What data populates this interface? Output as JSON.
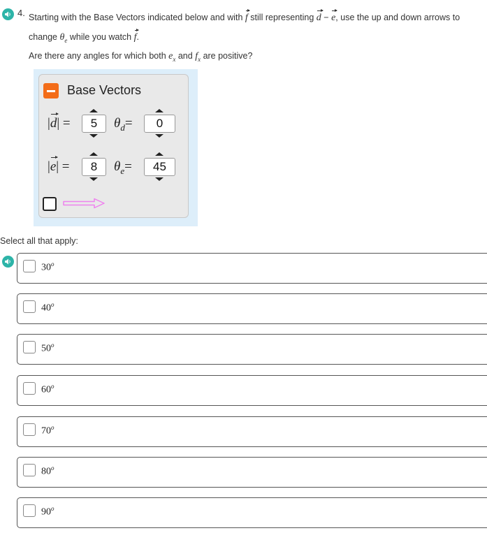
{
  "question": {
    "number": "4.",
    "line1_a": "Starting with the Base Vectors indicated below and with",
    "line1_f": "f",
    "line1_b": "still representing",
    "line1_d": "d",
    "line1_minus": "−",
    "line1_e": "e",
    "line1_c": ", use the up and down arrows to",
    "line2_a": "change",
    "line2_theta": "θ",
    "line2_sub": "e",
    "line2_b": "while you watch",
    "line2_f": "f",
    "line2_dot": ".",
    "line3_a": "Are there any angles for which both",
    "line3_e": "e",
    "line3_esub": "x",
    "line3_and": "and",
    "line3_f": "f",
    "line3_fsub": "x",
    "line3_b": "are positive?"
  },
  "widget": {
    "title": "Base Vectors",
    "d_label_left": "|",
    "d_label_sym": "d",
    "d_label_right": "| =",
    "d_magnitude": "5",
    "theta_d_sym": "θ",
    "theta_d_sub": "d",
    "theta_d_eq": "=",
    "theta_d": "0",
    "e_label_left": "|",
    "e_label_sym": "e",
    "e_label_right": "| =",
    "e_magnitude": "8",
    "theta_e_sym": "θ",
    "theta_e_sub": "e",
    "theta_e_eq": "=",
    "theta_e": "45",
    "arrow_color": "#ee82ee"
  },
  "select_label": "Select all that apply:",
  "options": [
    {
      "value": "30",
      "unit": "o"
    },
    {
      "value": "40",
      "unit": "o"
    },
    {
      "value": "50",
      "unit": "o"
    },
    {
      "value": "60",
      "unit": "o"
    },
    {
      "value": "70",
      "unit": "o"
    },
    {
      "value": "80",
      "unit": "o"
    },
    {
      "value": "90",
      "unit": "o"
    }
  ],
  "colors": {
    "audio": "#2db4a8",
    "collapse_button": "#f36c18",
    "widget_background": "#ddeefa"
  }
}
